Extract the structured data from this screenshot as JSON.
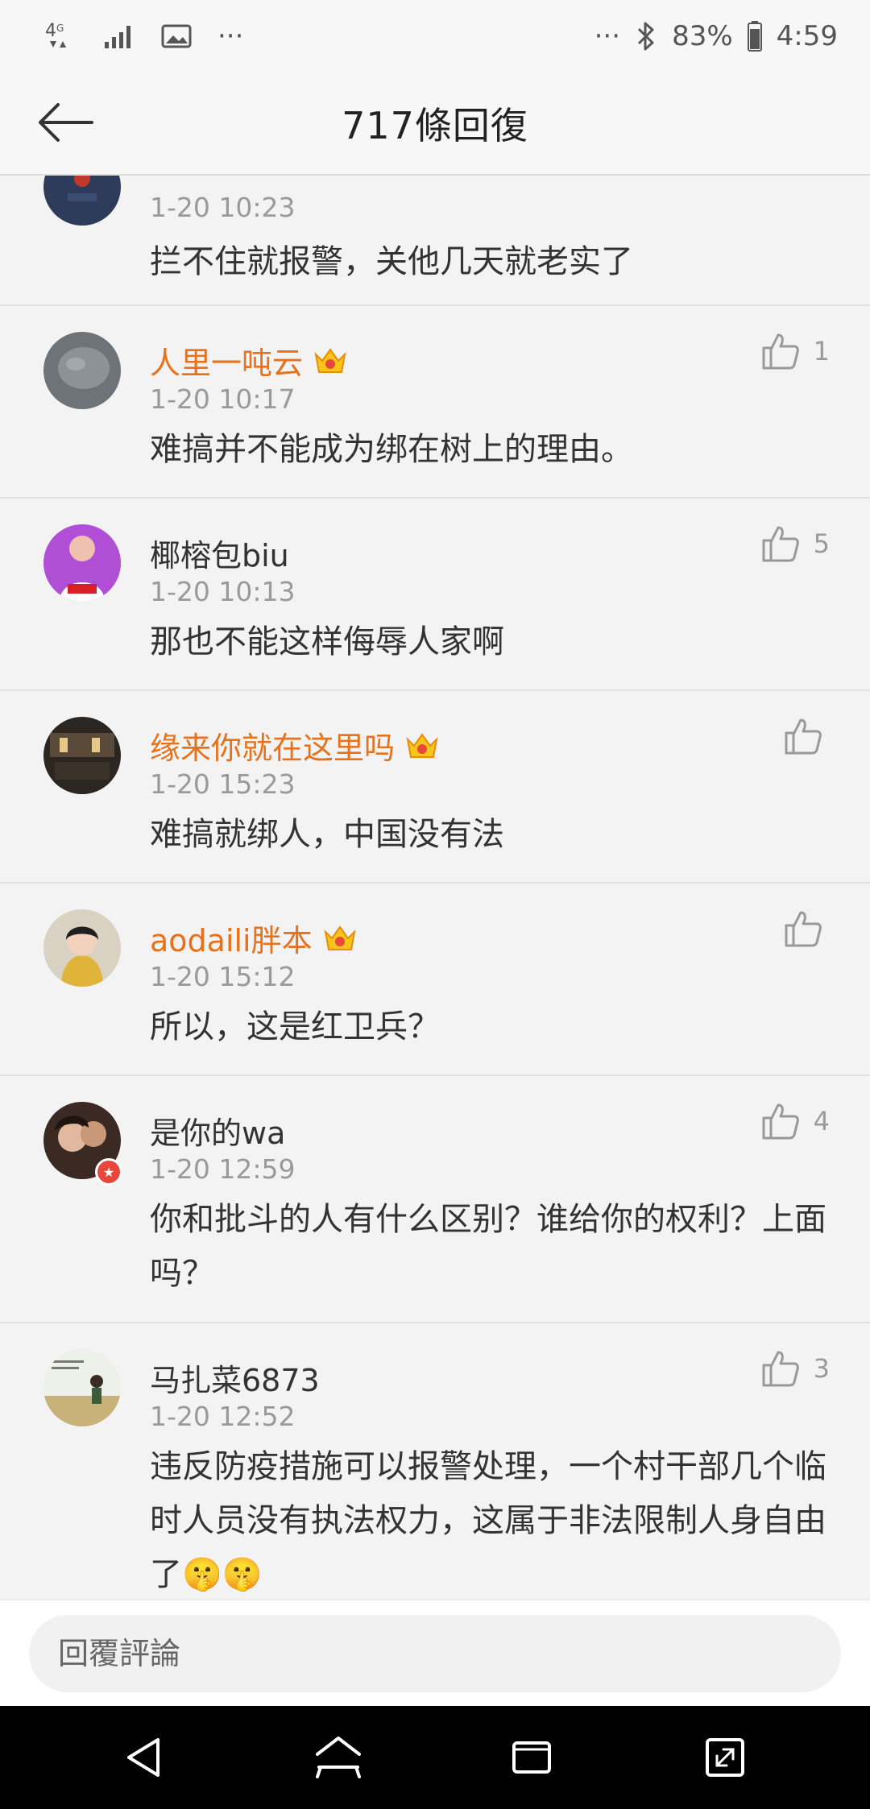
{
  "status_bar": {
    "network": "4G",
    "battery": "83%",
    "time": "4:59",
    "more": "···"
  },
  "header": {
    "title": "717條回復"
  },
  "comments": [
    {
      "name": "",
      "vip": false,
      "time": "1-20 10:23",
      "text": "拦不住就报警，关他几天就老实了",
      "likes": ""
    },
    {
      "name": "人里一吨云",
      "vip": true,
      "time": "1-20 10:17",
      "text": "难搞并不能成为绑在树上的理由。",
      "likes": "1"
    },
    {
      "name": "椰榕包biu",
      "vip": false,
      "time": "1-20 10:13",
      "text": "那也不能这样侮辱人家啊",
      "likes": "5"
    },
    {
      "name": "缘来你就在这里吗",
      "vip": true,
      "time": "1-20 15:23",
      "text": "难搞就绑人，中国没有法",
      "likes": ""
    },
    {
      "name": "aodaili胖本",
      "vip": true,
      "time": "1-20 15:12",
      "text": "所以，这是红卫兵？",
      "likes": ""
    },
    {
      "name": "是你的wa",
      "vip": false,
      "time": "1-20 12:59",
      "text": "你和批斗的人有什么区别？谁给你的权利？上面吗？",
      "likes": "4"
    },
    {
      "name": "马扎菜6873",
      "vip": false,
      "time": "1-20 12:52",
      "text": "违反防疫措施可以报警处理，一个村干部几个临时人员没有执法权力，这属于非法限制人身自由了🤫🤫",
      "likes": "3"
    }
  ],
  "reply": {
    "placeholder": "回覆評論"
  },
  "colors": {
    "vip_name": "#e8721c",
    "accent_badge": "#e8483b"
  }
}
